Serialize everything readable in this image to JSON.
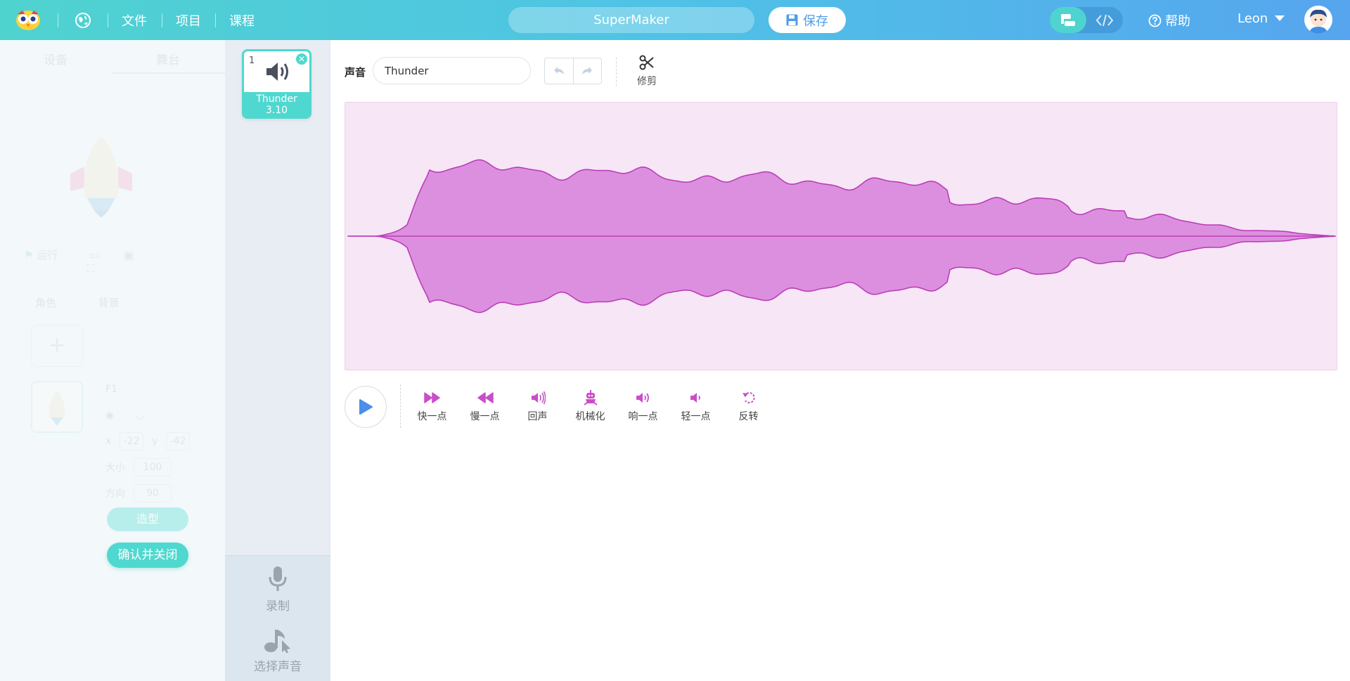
{
  "topbar": {
    "menu": [
      {
        "label": "文件"
      },
      {
        "label": "项目"
      },
      {
        "label": "课程"
      }
    ],
    "project_name": "SuperMaker",
    "save_label": "保存",
    "help_label": "帮助",
    "user_name": "Leon",
    "colors": {
      "gradient_start": "#4fd3cf",
      "gradient_end": "#56a5ee"
    }
  },
  "stage_panel": {
    "tabs": [
      "设备",
      "舞台"
    ],
    "toolbar": {
      "run_label": "运行"
    },
    "subtabs": [
      "角色",
      "背景"
    ],
    "sprite": {
      "name": "F1",
      "x": "-22",
      "y": "-42",
      "size_label": "大小",
      "size": "100",
      "direction_label": "方向",
      "direction": "90"
    },
    "shape_button": "造型",
    "confirm_button": "确认并关闭"
  },
  "sound_list": {
    "items": [
      {
        "index": "1",
        "name": "Thunder",
        "duration": "3.10"
      }
    ],
    "record_label": "录制",
    "choose_label": "选择声音"
  },
  "editor": {
    "sound_label": "声音",
    "sound_name": "Thunder",
    "trim_label": "修剪",
    "effects": [
      {
        "icon": "fast-forward-icon",
        "label": "快一点"
      },
      {
        "icon": "rewind-icon",
        "label": "慢一点"
      },
      {
        "icon": "echo-icon",
        "label": "回声"
      },
      {
        "icon": "robot-icon",
        "label": "机械化"
      },
      {
        "icon": "louder-icon",
        "label": "响一点"
      },
      {
        "icon": "softer-icon",
        "label": "轻一点"
      },
      {
        "icon": "reverse-icon",
        "label": "反转"
      }
    ],
    "colors": {
      "wave_fill": "#dd8fdf",
      "wave_stroke": "#b93fb8",
      "wave_bg": "#f7e6f6",
      "accent": "#4fd8cf"
    }
  }
}
